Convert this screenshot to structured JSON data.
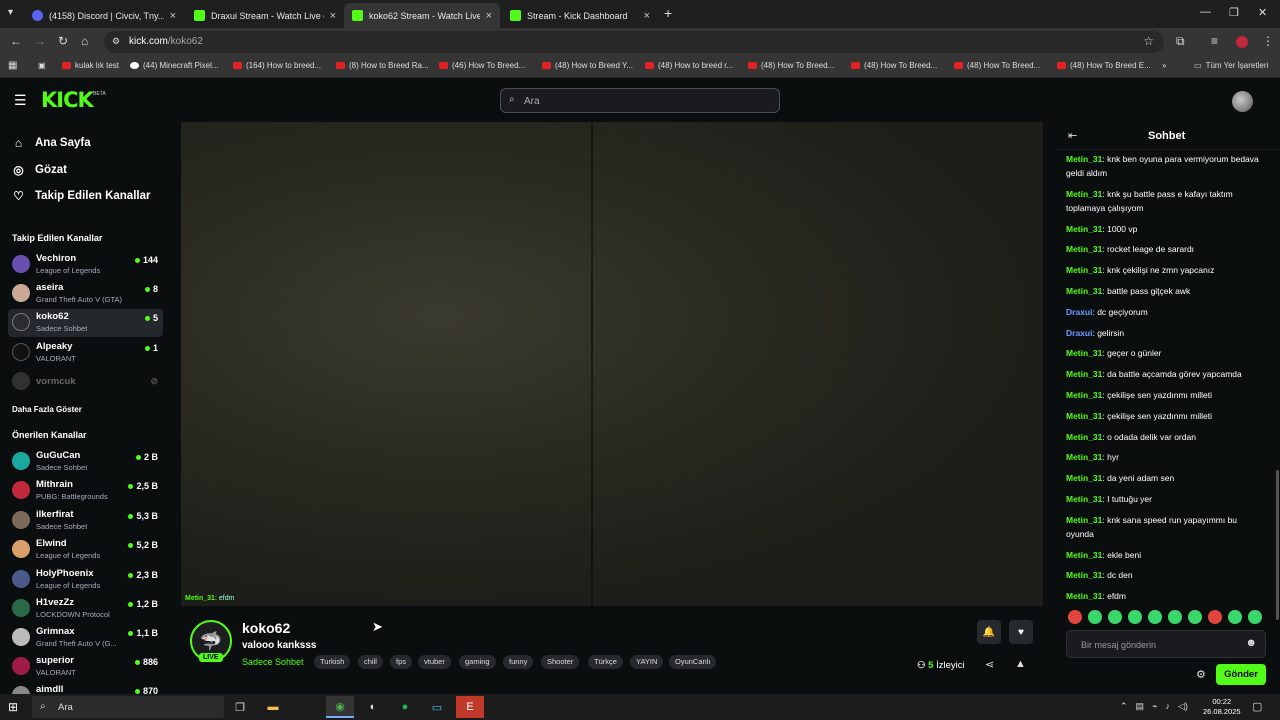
{
  "browser": {
    "tabs": [
      {
        "title": "(4158) Discord | Civciv, Tny...",
        "favicon_color": "#5865f2"
      },
      {
        "title": "Draxui Stream - Watch Live on ...",
        "favicon_color": "#53fc18"
      },
      {
        "title": "koko62 Stream - Watch Live on ...",
        "favicon_color": "#53fc18"
      },
      {
        "title": "Stream - Kick Dashboard",
        "favicon_color": "#53fc18"
      }
    ],
    "url_host": "kick.com",
    "url_path": "/koko62",
    "bookmarks": [
      "kulak lık test",
      "(44) Minecraft Pixel...",
      "(164) How to breed...",
      "(8) How to Breed Ra...",
      "(46) How To Breed...",
      "(48) How to Breed Y...",
      "(48) How to breed r...",
      "(48) How To Breed...",
      "(48) How To Breed...",
      "(48) How To Breed...",
      "(48) How To Breed E..."
    ],
    "bookmarks_all": "Tüm Yer İşaretleri"
  },
  "header": {
    "logo": "KICK",
    "beta": "BETA",
    "search_placeholder": "Ara"
  },
  "sidebar": {
    "nav": [
      {
        "label": "Ana Sayfa",
        "icon": "home-icon"
      },
      {
        "label": "Gözat",
        "icon": "browse-icon"
      },
      {
        "label": "Takip Edilen Kanallar",
        "icon": "heart-icon"
      }
    ],
    "followed_heading": "Takip Edilen Kanallar",
    "followed": [
      {
        "name": "Vechiron",
        "category": "League of Legends",
        "viewers": "144",
        "color": "#6a4fb3"
      },
      {
        "name": "aseira",
        "category": "Grand Theft Auto V (GTA)",
        "viewers": "8",
        "color": "#c9a996"
      },
      {
        "name": "koko62",
        "category": "Sadece Sohbet",
        "viewers": "5",
        "color": "#2a2c30"
      },
      {
        "name": "Alpeaky",
        "category": "VALORANT",
        "viewers": "1",
        "color": "#111"
      },
      {
        "name": "vormcuk",
        "category": "",
        "viewers": "",
        "color": "#555"
      }
    ],
    "show_more": "Daha Fazla Göster",
    "recommended_heading": "Önerilen Kanallar",
    "recommended": [
      {
        "name": "GuGuCan",
        "category": "Sadece Sohbet",
        "viewers": "2 B",
        "color": "#1aa9a0"
      },
      {
        "name": "Mithrain",
        "category": "PUBG: Battlegrounds",
        "viewers": "2,5 B",
        "color": "#c0283b"
      },
      {
        "name": "ilkerfirat",
        "category": "Sadece Sohbet",
        "viewers": "5,3 B",
        "color": "#7a6a5a"
      },
      {
        "name": "Elwind",
        "category": "League of Legends",
        "viewers": "5,2 B",
        "color": "#d8a06a"
      },
      {
        "name": "HolyPhoenix",
        "category": "League of Legends",
        "viewers": "2,3 B",
        "color": "#4a5a8a"
      },
      {
        "name": "H1vezZz",
        "category": "LOCKDOWN Protocol",
        "viewers": "1,2 B",
        "color": "#2a6a4a"
      },
      {
        "name": "Grimnax",
        "category": "Grand Theft Auto V (G...",
        "viewers": "1,1 B",
        "color": "#bbb"
      },
      {
        "name": "superior",
        "category": "VALORANT",
        "viewers": "886",
        "color": "#a01a4a"
      },
      {
        "name": "aimdll",
        "category": "",
        "viewers": "870",
        "color": "#888"
      }
    ]
  },
  "video": {
    "overlay_user": "Metin_31",
    "overlay_text": ": efdm"
  },
  "stream": {
    "name": "koko62",
    "title": "valooo kanksss",
    "category": "Sadece Sohbet",
    "live": "LIVE",
    "tags": [
      "Turkish",
      "chill",
      "fps",
      "vtuber",
      "gaming",
      "funny",
      "Shooter",
      "Türkçe",
      "YAYIN",
      "OyunCanlı"
    ],
    "viewers": "5",
    "viewers_label": "İzleyici"
  },
  "chat": {
    "title": "Sohbet",
    "messages": [
      {
        "user": "Metin_31",
        "text": ": knk ben oyuna para vermiyorum bedava geldi aldım",
        "color": "green"
      },
      {
        "user": "Metin_31",
        "text": ": knk şu battle pass e kafayı taktım toplamaya çalışıyom",
        "color": "green"
      },
      {
        "user": "Metin_31",
        "text": ": 1000 vp",
        "color": "green"
      },
      {
        "user": "Metin_31",
        "text": ": rocket leage de sarardı",
        "color": "green"
      },
      {
        "user": "Metin_31",
        "text": ": knk çekilişi ne zmn yapcanız",
        "color": "green"
      },
      {
        "user": "Metin_31",
        "text": ": battle pass giţçek awk",
        "color": "green"
      },
      {
        "user": "Draxui",
        "text": ": dc geçiyorum",
        "color": "blue"
      },
      {
        "user": "Draxui",
        "text": ": gelirsin",
        "color": "blue"
      },
      {
        "user": "Metin_31",
        "text": ": geçer o günler",
        "color": "green"
      },
      {
        "user": "Metin_31",
        "text": ": da battle açcamda görev yapcamda",
        "color": "green"
      },
      {
        "user": "Metin_31",
        "text": ": çekilişe sen yazdınmı milleti",
        "color": "green"
      },
      {
        "user": "Metin_31",
        "text": ": çekilişe sen yazdınmı milleti",
        "color": "green"
      },
      {
        "user": "Metin_31",
        "text": ": o odada delik var ordan",
        "color": "green"
      },
      {
        "user": "Metin_31",
        "text": ": hyr",
        "color": "green"
      },
      {
        "user": "Metin_31",
        "text": ": da yeni adam sen",
        "color": "green"
      },
      {
        "user": "Metin_31",
        "text": ": I tuttuğu yer",
        "color": "green"
      },
      {
        "user": "Metin_31",
        "text": ": knk sana speed run yapayımmı bu oyunda",
        "color": "green"
      },
      {
        "user": "Metin_31",
        "text": ": ekle beni",
        "color": "green"
      },
      {
        "user": "Metin_31",
        "text": ": dc den",
        "color": "green"
      },
      {
        "user": "Metin_31",
        "text": ": efdm",
        "color": "green"
      }
    ],
    "input_placeholder": "Bir mesaj gönderin",
    "send_label": "Gönder"
  },
  "taskbar": {
    "search_label": "Ara",
    "time": "00:22",
    "date": "26.08.2025"
  }
}
